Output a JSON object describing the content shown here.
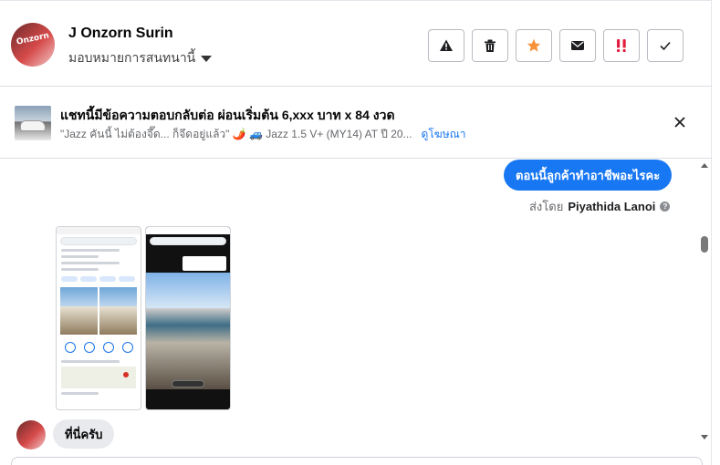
{
  "header": {
    "contact_name": "J Onzorn Surin",
    "avatar_text": "Onzorn",
    "assign_label": "มอบหมายการสนทนานี้",
    "actions": [
      {
        "icon": "warning-icon",
        "label": "Report"
      },
      {
        "icon": "trash-icon",
        "label": "Delete"
      },
      {
        "icon": "star-icon",
        "label": "Follow up"
      },
      {
        "icon": "envelope-icon",
        "label": "Mark as unread"
      },
      {
        "icon": "spam-icon",
        "label": "Spam"
      },
      {
        "icon": "check-icon",
        "label": "Mark as done"
      }
    ],
    "colors": {
      "star": "#f7923b",
      "spam": "#e41e3f"
    }
  },
  "ad": {
    "title": "แชทนี้มีข้อความตอบกลับต่อ ผ่อนเริ่มต้น 6,xxx บาท x 84 งวด",
    "snippet": "\"Jazz คันนี้ ไม่ต้องจึ๊ด... ก็จึดอยู่แล้ว\" 🌶️ 🚙 Jazz 1.5 V+ (MY14) AT ปี 20...",
    "link": "ดูโฆษณา"
  },
  "messages": {
    "outgoing_text": "ตอนนี้ลูกค้าทำอาชีพอะไรคะ",
    "sent_by_prefix": "ส่งโดย",
    "sent_by_name": "Piyathida Lanoi",
    "incoming_text": "ที่นี่ครับ"
  },
  "colors": {
    "accent": "#1877f2",
    "incoming_bubble": "#e9eaee"
  }
}
